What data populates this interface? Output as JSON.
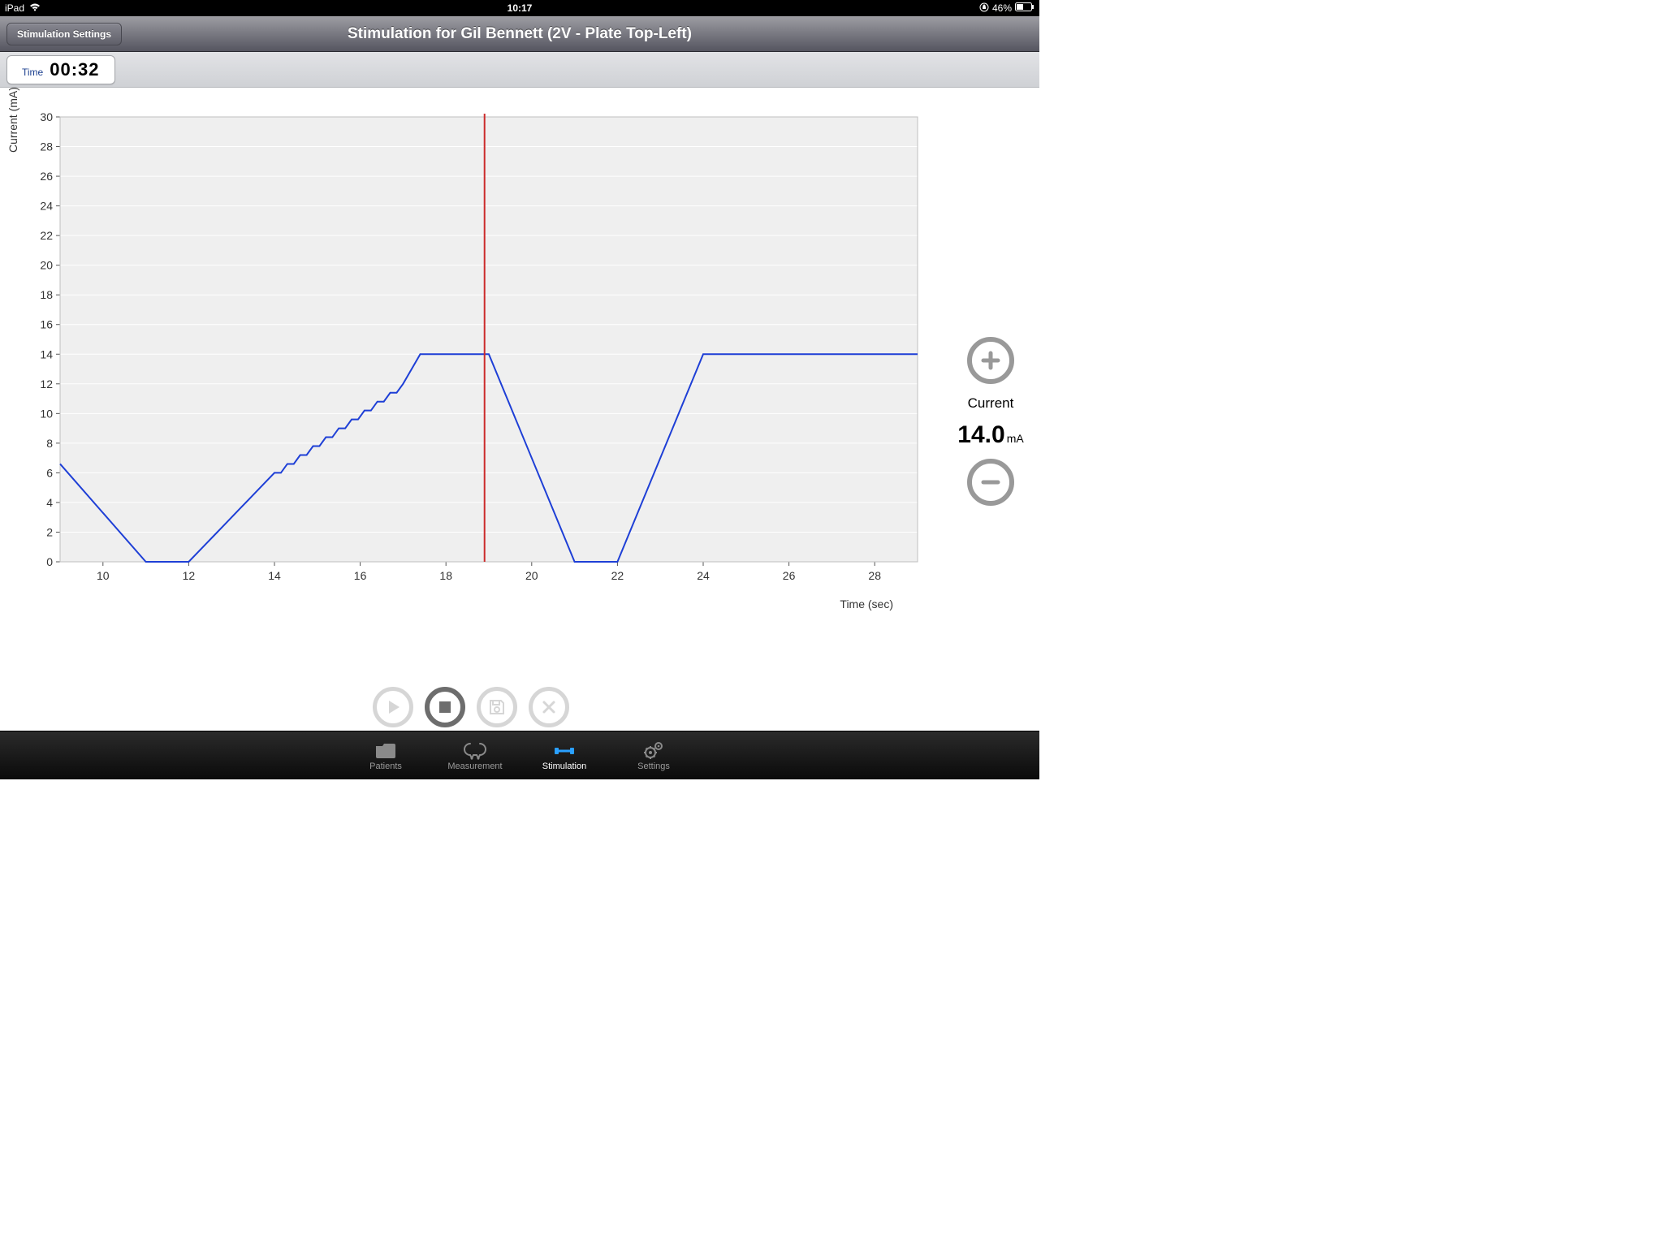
{
  "status": {
    "carrier": "iPad",
    "time": "10:17",
    "battery_pct": "46%"
  },
  "nav": {
    "left_button": "Stimulation Settings",
    "title": "Stimulation for Gil Bennett (2V - Plate Top-Left)"
  },
  "timer": {
    "label": "Time",
    "value": "00:32"
  },
  "side": {
    "label": "Current",
    "value": "14.0",
    "unit": "mA"
  },
  "tabs": [
    {
      "id": "patients",
      "label": "Patients"
    },
    {
      "id": "measurement",
      "label": "Measurement"
    },
    {
      "id": "stimulation",
      "label": "Stimulation",
      "active": true
    },
    {
      "id": "settings",
      "label": "Settings"
    }
  ],
  "chart_data": {
    "type": "line",
    "ylabel": "Current (mA)",
    "xlabel": "Time (sec)",
    "xlim": [
      9,
      29
    ],
    "ylim": [
      0,
      30
    ],
    "xticks": [
      10,
      12,
      14,
      16,
      18,
      20,
      22,
      24,
      26,
      28
    ],
    "yticks": [
      0,
      2,
      4,
      6,
      8,
      10,
      12,
      14,
      16,
      18,
      20,
      22,
      24,
      26,
      28,
      30
    ],
    "cursor_x": 18.9,
    "series": [
      {
        "name": "current",
        "color": "#1e3fd6",
        "points": [
          [
            9.0,
            6.6
          ],
          [
            11.0,
            0.0
          ],
          [
            12.0,
            0.0
          ],
          [
            12.4,
            1.2
          ],
          [
            12.6,
            1.8
          ],
          [
            12.8,
            2.4
          ],
          [
            13.0,
            3.0
          ],
          [
            13.2,
            3.6
          ],
          [
            13.4,
            4.2
          ],
          [
            13.6,
            4.8
          ],
          [
            13.8,
            5.4
          ],
          [
            14.0,
            6.0
          ],
          [
            14.15,
            6.0
          ],
          [
            14.3,
            6.6
          ],
          [
            14.45,
            6.6
          ],
          [
            14.6,
            7.2
          ],
          [
            14.75,
            7.2
          ],
          [
            14.9,
            7.8
          ],
          [
            15.05,
            7.8
          ],
          [
            15.2,
            8.4
          ],
          [
            15.35,
            8.4
          ],
          [
            15.5,
            9.0
          ],
          [
            15.65,
            9.0
          ],
          [
            15.8,
            9.6
          ],
          [
            15.95,
            9.6
          ],
          [
            16.1,
            10.2
          ],
          [
            16.25,
            10.2
          ],
          [
            16.4,
            10.8
          ],
          [
            16.55,
            10.8
          ],
          [
            16.7,
            11.4
          ],
          [
            16.85,
            11.4
          ],
          [
            17.0,
            12.0
          ],
          [
            17.4,
            14.0
          ],
          [
            19.0,
            14.0
          ],
          [
            21.0,
            0.0
          ],
          [
            22.0,
            0.0
          ],
          [
            24.0,
            14.0
          ],
          [
            29.0,
            14.0
          ]
        ]
      }
    ]
  }
}
